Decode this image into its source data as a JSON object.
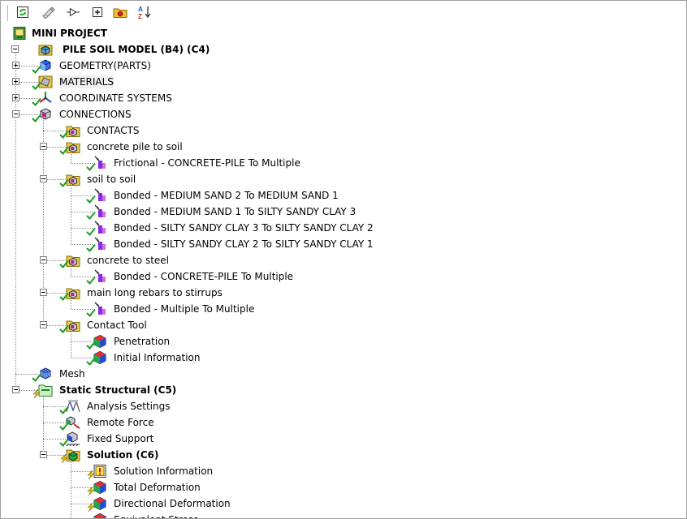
{
  "toolbar": {
    "buttons": [
      {
        "name": "refresh-button",
        "icon": "refresh-icon"
      },
      {
        "name": "edit-button",
        "icon": "pencil-icon"
      },
      {
        "name": "connect-button",
        "icon": "probe-icon"
      },
      {
        "name": "expand-all-button",
        "icon": "expand-icon"
      },
      {
        "name": "open-folder-button",
        "icon": "folder-icon"
      },
      {
        "name": "sort-az-button",
        "icon": "sort-az-icon"
      }
    ]
  },
  "tree": {
    "rows": [
      {
        "label": "MINI PROJECT",
        "bold": true,
        "level": 0,
        "icon": "project",
        "expander": null,
        "status": null
      },
      {
        "label": "PILE SOIL MODEL (B4) (C4)",
        "bold": true,
        "level": 0,
        "icon": "model",
        "expander": "minus",
        "status": null
      },
      {
        "label": "GEOMETRY(PARTS)",
        "level": 1,
        "icon": "geometry",
        "expander": "plus",
        "status": "check"
      },
      {
        "label": "MATERIALS",
        "level": 1,
        "icon": "materials",
        "expander": "plus",
        "status": "check",
        "selected": true
      },
      {
        "label": "COORDINATE SYSTEMS",
        "level": 1,
        "icon": "axes",
        "expander": "plus",
        "status": "check"
      },
      {
        "label": "CONNECTIONS",
        "level": 1,
        "icon": "connections",
        "expander": "minus",
        "status": "check"
      },
      {
        "label": "CONTACTS",
        "level": 2,
        "icon": "folder",
        "expander": null,
        "status": "check"
      },
      {
        "label": "concrete pile to soil",
        "level": 2,
        "icon": "folder",
        "expander": "minus",
        "status": "check"
      },
      {
        "label": "Frictional - CONCRETE-PILE To Multiple",
        "level": 3,
        "icon": "contact",
        "expander": null,
        "status": "check"
      },
      {
        "label": "soil to soil",
        "level": 2,
        "icon": "folder",
        "expander": "minus",
        "status": "check"
      },
      {
        "label": "Bonded - MEDIUM  SAND 2 To MEDIUM SAND 1",
        "level": 3,
        "icon": "contact",
        "expander": null,
        "status": "check"
      },
      {
        "label": "Bonded - MEDIUM SAND 1 To SILTY SANDY CLAY 3",
        "level": 3,
        "icon": "contact",
        "expander": null,
        "status": "check"
      },
      {
        "label": "Bonded - SILTY SANDY CLAY 3 To SILTY SANDY CLAY 2",
        "level": 3,
        "icon": "contact",
        "expander": null,
        "status": "check"
      },
      {
        "label": "Bonded - SILTY SANDY CLAY 2 To SILTY SANDY CLAY 1",
        "level": 3,
        "icon": "contact",
        "expander": null,
        "status": "check"
      },
      {
        "label": "concrete to steel",
        "level": 2,
        "icon": "folder",
        "expander": "minus",
        "status": "check"
      },
      {
        "label": "Bonded - CONCRETE-PILE To Multiple",
        "level": 3,
        "icon": "contact",
        "expander": null,
        "status": "check"
      },
      {
        "label": "main long rebars to stirrups",
        "level": 2,
        "icon": "folder",
        "expander": "minus",
        "status": "check"
      },
      {
        "label": "Bonded - Multiple To Multiple",
        "level": 3,
        "icon": "contact",
        "expander": null,
        "status": "check"
      },
      {
        "label": "Contact Tool",
        "level": 2,
        "icon": "folder",
        "expander": "minus",
        "status": "check"
      },
      {
        "label": "Penetration",
        "level": 3,
        "icon": "result",
        "expander": null,
        "status": "check"
      },
      {
        "label": "Initial Information",
        "level": 3,
        "icon": "result",
        "expander": null,
        "status": "check"
      },
      {
        "label": "Mesh",
        "level": 1,
        "icon": "mesh",
        "expander": null,
        "status": "check"
      },
      {
        "label": "Static Structural (C5)",
        "bold": true,
        "level": 1,
        "icon": "analysis",
        "expander": "minus",
        "status": "bolt"
      },
      {
        "label": "Analysis Settings",
        "level": 2,
        "icon": "settings",
        "expander": null,
        "status": "check"
      },
      {
        "label": "Remote Force",
        "level": 2,
        "icon": "force",
        "expander": null,
        "status": "check"
      },
      {
        "label": "Fixed Support",
        "level": 2,
        "icon": "support",
        "expander": null,
        "status": "check"
      },
      {
        "label": "Solution (C6)",
        "bold": true,
        "level": 2,
        "icon": "solution",
        "expander": "minus",
        "status": "bolt"
      },
      {
        "label": "Solution Information",
        "level": 3,
        "icon": "info",
        "expander": null,
        "status": "bolt"
      },
      {
        "label": "Total Deformation",
        "level": 3,
        "icon": "result",
        "expander": null,
        "status": "bolt"
      },
      {
        "label": "Directional Deformation",
        "level": 3,
        "icon": "result",
        "expander": null,
        "status": "bolt"
      },
      {
        "label": "Equivalent Stress",
        "level": 3,
        "icon": "result",
        "expander": null,
        "status": "bolt"
      }
    ]
  },
  "colors": {
    "check": "#1a9e1a",
    "bolt": "#e8c400",
    "contact": "#8a2be2",
    "folder": "#e8c84a",
    "result_green": "#22a84a",
    "result_blue": "#1e4fd0"
  }
}
